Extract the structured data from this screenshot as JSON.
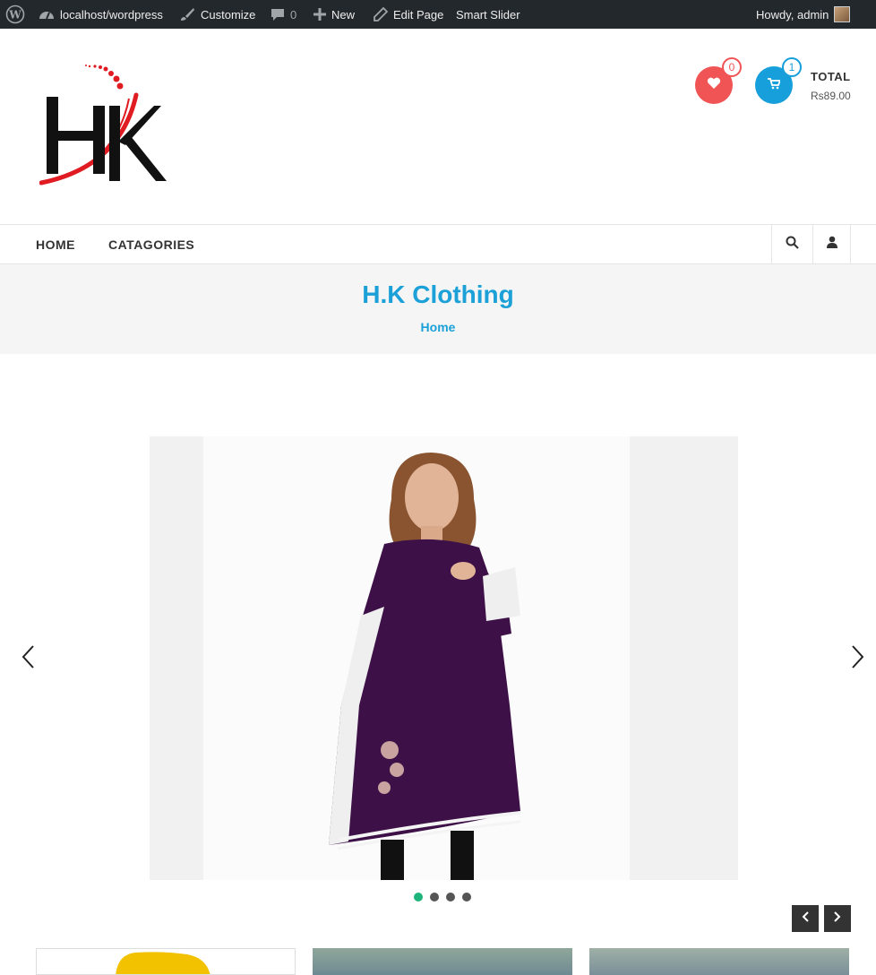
{
  "admin_bar": {
    "site": "localhost/wordpress",
    "customize": "Customize",
    "comments_count": "0",
    "new": "New",
    "edit_page": "Edit Page",
    "smart_slider": "Smart Slider",
    "greeting": "Howdy, admin"
  },
  "header": {
    "logo_text": "HK",
    "wishlist_count": "0",
    "cart_count": "1",
    "total_label": "TOTAL",
    "total_value": "Rs89.00"
  },
  "nav": {
    "items": [
      {
        "label": "HOME"
      },
      {
        "label": "CATAGORIES"
      }
    ]
  },
  "banner": {
    "title": "H.K Clothing",
    "breadcrumb": "Home"
  },
  "slider": {
    "slide_count": 4,
    "active_index": 0,
    "colors": {
      "dress": "#3d1147",
      "active_dot": "#1eb57d",
      "accent": "#1ba0d8"
    }
  }
}
